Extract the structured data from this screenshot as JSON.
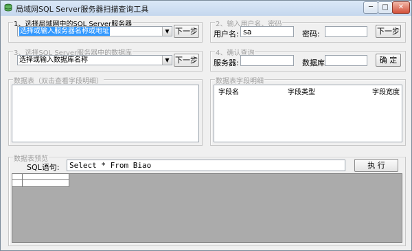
{
  "window": {
    "title": "局域网SQL Server服务器扫描查询工具",
    "controls": {
      "minimize": "─",
      "maximize": "□",
      "close": "✕"
    }
  },
  "group1": {
    "legend": "1、选择局域网中的SQL Server服务器",
    "server_combo_value": "选择或输入服务器名称或地址",
    "next_button": "下一步"
  },
  "group2": {
    "legend": "2、输入用户名、密码",
    "username_label": "用户名:",
    "username_value": "sa",
    "password_label": "密码:",
    "password_value": "",
    "next_button": "下一步"
  },
  "group3": {
    "legend": "3、选择SQL Server服务器中的数据库",
    "database_combo_value": "选择或输入数据库名称",
    "next_button": "下一步"
  },
  "group4": {
    "legend": "4、确认查询",
    "server_label": "服务器:",
    "server_value": "",
    "database_label": "数据库:",
    "database_value": "",
    "confirm_button": "确 定"
  },
  "tables_group": {
    "legend": "数据表（双击查看字段明细）"
  },
  "fields_group": {
    "legend": "数据表字段明细",
    "columns": [
      "字段名",
      "字段类型",
      "字段宽度"
    ]
  },
  "preview_group": {
    "legend": "数据表预览",
    "sql_label": "SQL语句:",
    "sql_value": "Select * From Biao",
    "execute_button": "执 行"
  }
}
